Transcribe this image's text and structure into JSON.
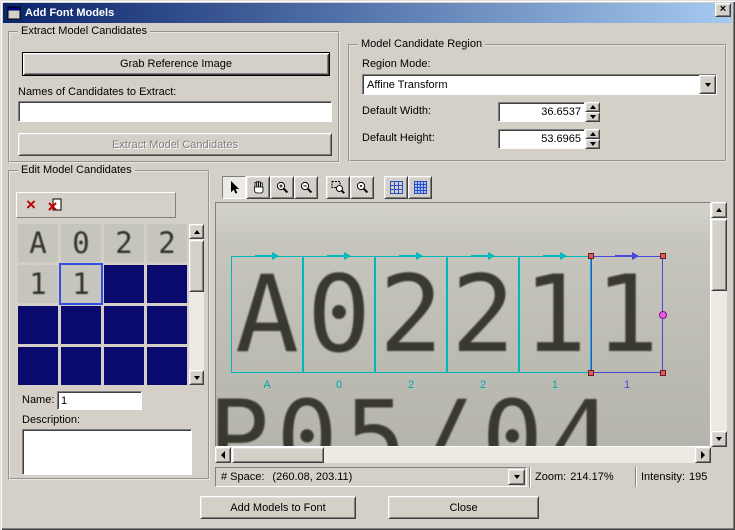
{
  "window": {
    "title": "Add Font Models",
    "close_glyph": "×"
  },
  "extract_group": {
    "title": "Extract Model Candidates",
    "grab_button_label": "Grab Reference Image",
    "names_label": "Names of Candidates to Extract:",
    "names_value": "",
    "extract_button_label": "Extract Model Candidates"
  },
  "region_group": {
    "title": "Model Candidate Region",
    "region_mode_label": "Region Mode:",
    "region_mode_value": "Affine Transform",
    "default_width_label": "Default Width:",
    "default_width_value": "36.6537",
    "default_height_label": "Default Height:",
    "default_height_value": "53.6965"
  },
  "edit_group": {
    "title": "Edit Model Candidates",
    "delete_glyph": "×",
    "cells": [
      "A",
      "0",
      "2",
      "2",
      "1",
      "1",
      "",
      "",
      "",
      "",
      "",
      "",
      "",
      "",
      "",
      ""
    ],
    "selected_index": 5,
    "name_label": "Name:",
    "name_value": "1",
    "description_label": "Description:",
    "description_value": ""
  },
  "viewer": {
    "toolbar_tools": [
      "pointer-tool",
      "pan-tool",
      "zoom-in",
      "zoom-out",
      "zoom-region",
      "zoom-fit",
      "grid-lines",
      "grid-cells"
    ],
    "characters": [
      {
        "glyph": "A",
        "label": "A",
        "selected": false
      },
      {
        "glyph": "0",
        "label": "0",
        "selected": false
      },
      {
        "glyph": "2",
        "label": "2",
        "selected": false
      },
      {
        "glyph": "2",
        "label": "2",
        "selected": false
      },
      {
        "glyph": "1",
        "label": "1",
        "selected": false
      },
      {
        "glyph": "1",
        "label": "1",
        "selected": true
      }
    ],
    "partial_row_text": "P05/04",
    "status": {
      "space_label": "# Space:",
      "space_value": "(260.08, 203.11)",
      "zoom_label": "Zoom:",
      "zoom_value": "214.17%",
      "intensity_label": "Intensity:",
      "intensity_value": "195"
    }
  },
  "footer": {
    "add_button_label": "Add Models to Font",
    "close_button_label": "Close"
  },
  "colors": {
    "titlebar_left": "#0a246a",
    "titlebar_right": "#a6caf0",
    "dialog_bg": "#d4d0c8",
    "empty_cell_navy": "#0a0a6e",
    "marker_cyan": "#00b8b8",
    "selected_region_blue": "#4848d8",
    "handle_red": "#d86060",
    "rotate_handle_magenta": "#e060e0"
  }
}
